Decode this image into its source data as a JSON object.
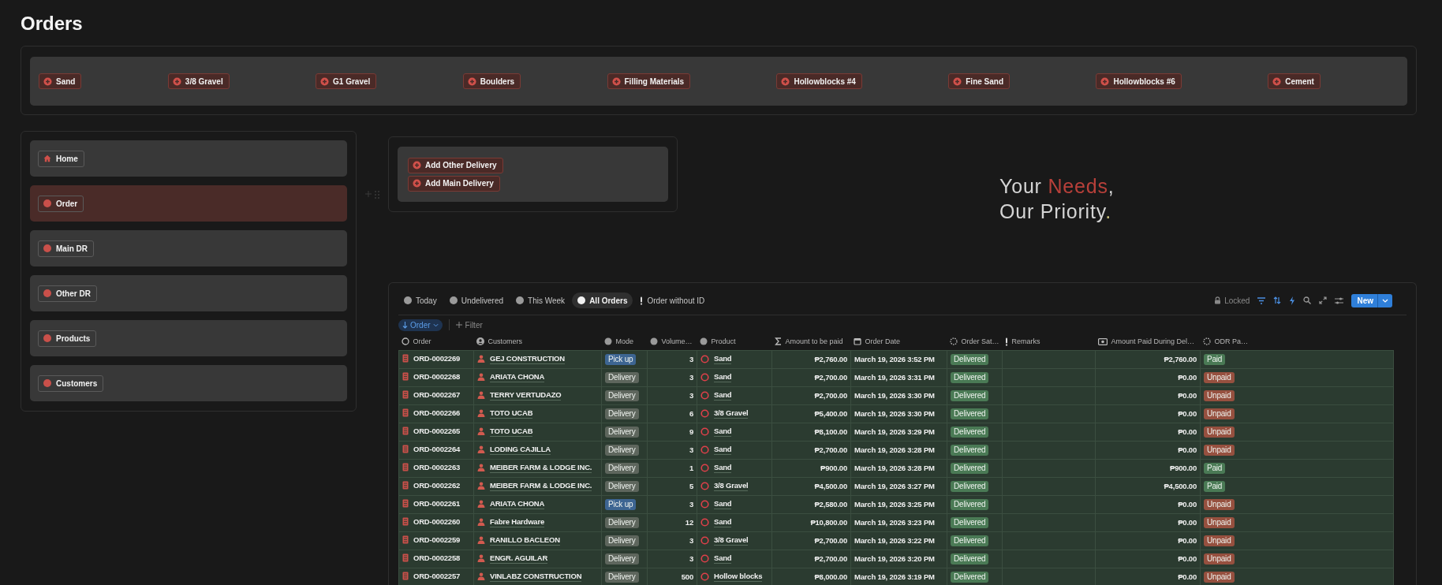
{
  "page": {
    "title": "Orders"
  },
  "product_chips": [
    {
      "label": "Sand"
    },
    {
      "label": "3/8 Gravel"
    },
    {
      "label": "G1 Gravel"
    },
    {
      "label": "Boulders"
    },
    {
      "label": "Filling Materials"
    },
    {
      "label": "Hollowblocks #4"
    },
    {
      "label": "Fine Sand"
    },
    {
      "label": "Hollowblocks #6"
    },
    {
      "label": "Cement"
    }
  ],
  "nav": [
    {
      "label": "Home",
      "kind": "home",
      "selected": false
    },
    {
      "label": "Order",
      "kind": "page",
      "selected": true
    },
    {
      "label": "Main DR",
      "kind": "page",
      "selected": false
    },
    {
      "label": "Other DR",
      "kind": "page",
      "selected": false
    },
    {
      "label": "Products",
      "kind": "page",
      "selected": false
    },
    {
      "label": "Customers",
      "kind": "page",
      "selected": false
    }
  ],
  "actions": [
    {
      "label": "Add Other Delivery"
    },
    {
      "label": "Add Main Delivery"
    }
  ],
  "slogan": {
    "lines": [
      [
        {
          "text": "Your ",
          "kind": "plain"
        },
        {
          "text": "Needs",
          "kind": "red"
        },
        {
          "text": ",",
          "kind": "plain"
        }
      ],
      [
        {
          "text": "Our Priority",
          "kind": "plain"
        },
        {
          "text": ".",
          "kind": "olive"
        }
      ]
    ]
  },
  "table": {
    "views": [
      {
        "label": "Today",
        "kind": "dot",
        "selected": false
      },
      {
        "label": "Undelivered",
        "kind": "dot",
        "selected": false
      },
      {
        "label": "This Week",
        "kind": "dot",
        "selected": false
      },
      {
        "label": "All Orders",
        "kind": "dot",
        "selected": true
      },
      {
        "label": "Order without ID",
        "kind": "alert",
        "selected": false
      }
    ],
    "locked": "Locked",
    "new_button": "New",
    "sort": "Order",
    "filter": "Filter",
    "columns": [
      {
        "label": "Order"
      },
      {
        "label": "Customers"
      },
      {
        "label": "Mode"
      },
      {
        "label": "Volume…"
      },
      {
        "label": "Product"
      },
      {
        "label": "Amount to be paid"
      },
      {
        "label": "Order Date"
      },
      {
        "label": "Order Sat…"
      },
      {
        "label": "Remarks"
      },
      {
        "label": "Amount Paid During Del…"
      },
      {
        "label": "ODR Pa…"
      }
    ],
    "rows": [
      {
        "order": "ORD-0002269",
        "customer": "GEJ CONSTRUCTION",
        "mode": {
          "label": "Pick up",
          "color": "#3d6592"
        },
        "volume": "3",
        "product": "Sand",
        "amount": "₱2,760.00",
        "date": "March 19, 2026 3:52 PM",
        "status": {
          "label": "Delivered",
          "color": "#4a7a55"
        },
        "paid": "₱2,760.00",
        "payment": {
          "label": "Paid",
          "color": "#4a7a55"
        }
      },
      {
        "order": "ORD-0002268",
        "customer": "ARIATA CHONA",
        "mode": {
          "label": "Delivery",
          "color": "#5e665d"
        },
        "volume": "3",
        "product": "Sand",
        "amount": "₱2,700.00",
        "date": "March 19, 2026 3:31 PM",
        "status": {
          "label": "Delivered",
          "color": "#4a7a55"
        },
        "paid": "₱0.00",
        "payment": {
          "label": "Unpaid",
          "color": "#96503f"
        }
      },
      {
        "order": "ORD-0002267",
        "customer": "TERRY VERTUDAZO",
        "mode": {
          "label": "Delivery",
          "color": "#5e665d"
        },
        "volume": "3",
        "product": "Sand",
        "amount": "₱2,700.00",
        "date": "March 19, 2026 3:30 PM",
        "status": {
          "label": "Delivered",
          "color": "#4a7a55"
        },
        "paid": "₱0.00",
        "payment": {
          "label": "Unpaid",
          "color": "#96503f"
        }
      },
      {
        "order": "ORD-0002266",
        "customer": "TOTO UCAB",
        "mode": {
          "label": "Delivery",
          "color": "#5e665d"
        },
        "volume": "6",
        "product": "3/8 Gravel",
        "amount": "₱5,400.00",
        "date": "March 19, 2026 3:30 PM",
        "status": {
          "label": "Delivered",
          "color": "#4a7a55"
        },
        "paid": "₱0.00",
        "payment": {
          "label": "Unpaid",
          "color": "#96503f"
        }
      },
      {
        "order": "ORD-0002265",
        "customer": "TOTO UCAB",
        "mode": {
          "label": "Delivery",
          "color": "#5e665d"
        },
        "volume": "9",
        "product": "Sand",
        "amount": "₱8,100.00",
        "date": "March 19, 2026 3:29 PM",
        "status": {
          "label": "Delivered",
          "color": "#4a7a55"
        },
        "paid": "₱0.00",
        "payment": {
          "label": "Unpaid",
          "color": "#96503f"
        }
      },
      {
        "order": "ORD-0002264",
        "customer": "LODING CAJILLA",
        "mode": {
          "label": "Delivery",
          "color": "#5e665d"
        },
        "volume": "3",
        "product": "Sand",
        "amount": "₱2,700.00",
        "date": "March 19, 2026 3:28 PM",
        "status": {
          "label": "Delivered",
          "color": "#4a7a55"
        },
        "paid": "₱0.00",
        "payment": {
          "label": "Unpaid",
          "color": "#96503f"
        }
      },
      {
        "order": "ORD-0002263",
        "customer": "MEIBER FARM & LODGE INC.",
        "mode": {
          "label": "Delivery",
          "color": "#5e665d"
        },
        "volume": "1",
        "product": "Sand",
        "amount": "₱900.00",
        "date": "March 19, 2026 3:28 PM",
        "status": {
          "label": "Delivered",
          "color": "#4a7a55"
        },
        "paid": "₱900.00",
        "payment": {
          "label": "Paid",
          "color": "#4a7a55"
        }
      },
      {
        "order": "ORD-0002262",
        "customer": "MEIBER FARM & LODGE INC.",
        "mode": {
          "label": "Delivery",
          "color": "#5e665d"
        },
        "volume": "5",
        "product": "3/8 Gravel",
        "amount": "₱4,500.00",
        "date": "March 19, 2026 3:27 PM",
        "status": {
          "label": "Delivered",
          "color": "#4a7a55"
        },
        "paid": "₱4,500.00",
        "payment": {
          "label": "Paid",
          "color": "#4a7a55"
        }
      },
      {
        "order": "ORD-0002261",
        "customer": "ARIATA CHONA",
        "mode": {
          "label": "Pick up",
          "color": "#3d6592"
        },
        "volume": "3",
        "product": "Sand",
        "amount": "₱2,580.00",
        "date": "March 19, 2026 3:25 PM",
        "status": {
          "label": "Delivered",
          "color": "#4a7a55"
        },
        "paid": "₱0.00",
        "payment": {
          "label": "Unpaid",
          "color": "#96503f"
        }
      },
      {
        "order": "ORD-0002260",
        "customer": "Fabre Hardware",
        "mode": {
          "label": "Delivery",
          "color": "#5e665d"
        },
        "volume": "12",
        "product": "Sand",
        "amount": "₱10,800.00",
        "date": "March 19, 2026 3:23 PM",
        "status": {
          "label": "Delivered",
          "color": "#4a7a55"
        },
        "paid": "₱0.00",
        "payment": {
          "label": "Unpaid",
          "color": "#96503f"
        }
      },
      {
        "order": "ORD-0002259",
        "customer": "RANILLO BACLEON",
        "mode": {
          "label": "Delivery",
          "color": "#5e665d"
        },
        "volume": "3",
        "product": "3/8 Gravel",
        "amount": "₱2,700.00",
        "date": "March 19, 2026 3:22 PM",
        "status": {
          "label": "Delivered",
          "color": "#4a7a55"
        },
        "paid": "₱0.00",
        "payment": {
          "label": "Unpaid",
          "color": "#96503f"
        }
      },
      {
        "order": "ORD-0002258",
        "customer": "ENGR. AGUILAR",
        "mode": {
          "label": "Delivery",
          "color": "#5e665d"
        },
        "volume": "3",
        "product": "Sand",
        "amount": "₱2,700.00",
        "date": "March 19, 2026 3:20 PM",
        "status": {
          "label": "Delivered",
          "color": "#4a7a55"
        },
        "paid": "₱0.00",
        "payment": {
          "label": "Unpaid",
          "color": "#96503f"
        }
      },
      {
        "order": "ORD-0002257",
        "customer": "VINLABZ CONSTRUCTION",
        "mode": {
          "label": "Delivery",
          "color": "#5e665d"
        },
        "volume": "500",
        "product": "Hollow blocks",
        "amount": "₱8,000.00",
        "date": "March 19, 2026 3:19 PM",
        "status": {
          "label": "Delivered",
          "color": "#4a7a55"
        },
        "paid": "₱0.00",
        "payment": {
          "label": "Unpaid",
          "color": "#96503f"
        }
      }
    ]
  }
}
